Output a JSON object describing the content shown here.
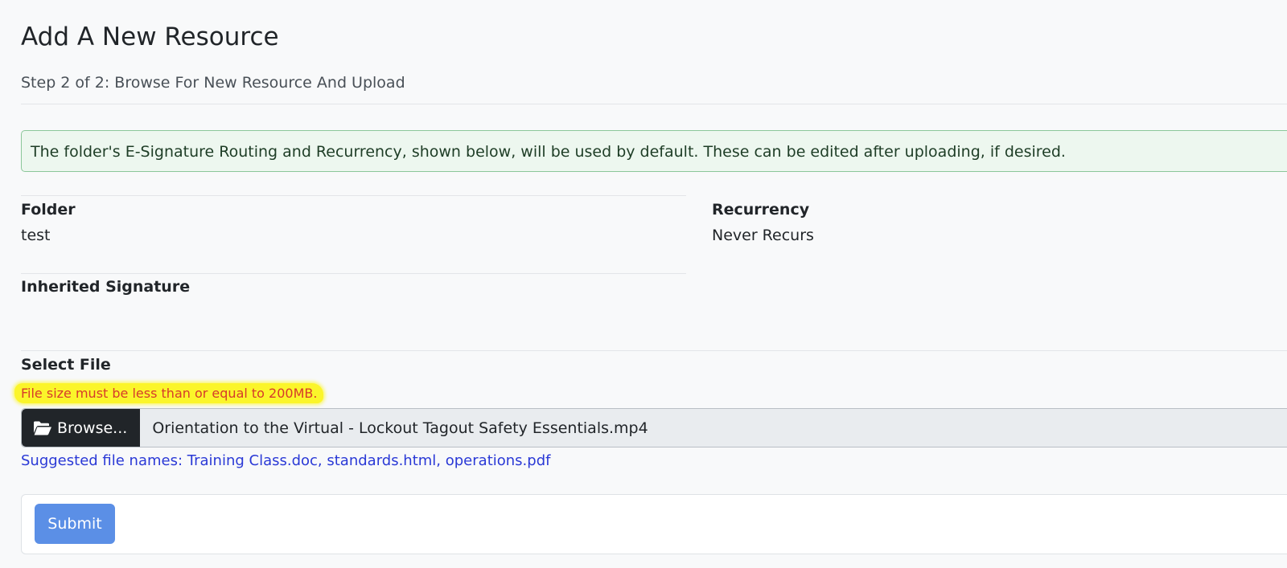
{
  "header": {
    "title": "Add A New Resource",
    "subtitle": "Step 2 of 2: Browse For New Resource And Upload"
  },
  "alert": {
    "text": "The folder's E-Signature Routing and Recurrency, shown below, will be used by default. These can be edited after uploading, if desired."
  },
  "details": {
    "folder_label": "Folder",
    "folder_value": "test",
    "recurrency_label": "Recurrency",
    "recurrency_value": "Never Recurs",
    "signature_label": "Inherited Signature"
  },
  "file_select": {
    "label": "Select File",
    "size_warning": "File size must be less than or equal to 200MB.",
    "browse_label": "Browse...",
    "browse_icon": "folder-open-icon",
    "selected_file": "Orientation to the Virtual - Lockout Tagout Safety Essentials.mp4",
    "suggested": "Suggested file names: Training Class.doc, standards.html, operations.pdf"
  },
  "actions": {
    "submit_label": "Submit"
  },
  "colors": {
    "primary": "#5b8fe6",
    "alert_bg": "#edf7ef",
    "alert_border": "#8bc79a",
    "highlight": "#fbf52a",
    "warning_text": "#d63b2b",
    "link": "#2a39d6",
    "dark_button": "#212529"
  }
}
